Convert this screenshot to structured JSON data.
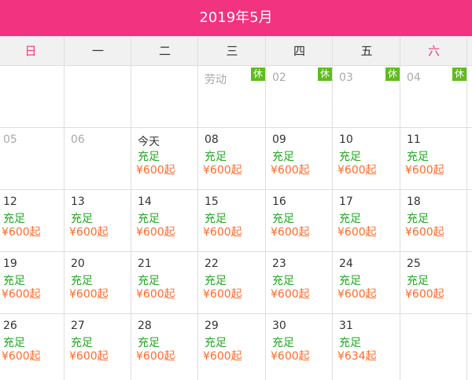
{
  "calendar": {
    "title": "2019年5月",
    "colors": {
      "accent": "#f2337f",
      "available": "#22a722",
      "price": "#ff6a2b",
      "holiday_badge": "#5fbc1e"
    },
    "weekdays": [
      "日",
      "一",
      "二",
      "三",
      "四",
      "五",
      "六"
    ],
    "weeks": [
      [
        {
          "day": "",
          "status": "",
          "price": "",
          "badge": "",
          "dim": false
        },
        {
          "day": "",
          "status": "",
          "price": "",
          "badge": "",
          "dim": false
        },
        {
          "day": "",
          "status": "",
          "price": "",
          "badge": "",
          "dim": false
        },
        {
          "day": "劳动",
          "status": "",
          "price": "",
          "badge": "休",
          "dim": true
        },
        {
          "day": "02",
          "status": "",
          "price": "",
          "badge": "休",
          "dim": true
        },
        {
          "day": "03",
          "status": "",
          "price": "",
          "badge": "休",
          "dim": true
        },
        {
          "day": "04",
          "status": "",
          "price": "",
          "badge": "休",
          "dim": true
        }
      ],
      [
        {
          "day": "05",
          "status": "",
          "price": "",
          "badge": "",
          "dim": true
        },
        {
          "day": "06",
          "status": "",
          "price": "",
          "badge": "",
          "dim": true
        },
        {
          "day": "今天",
          "status": "充足",
          "price": "¥600起",
          "badge": "",
          "dim": false
        },
        {
          "day": "08",
          "status": "充足",
          "price": "¥600起",
          "badge": "",
          "dim": false
        },
        {
          "day": "09",
          "status": "充足",
          "price": "¥600起",
          "badge": "",
          "dim": false
        },
        {
          "day": "10",
          "status": "充足",
          "price": "¥600起",
          "badge": "",
          "dim": false
        },
        {
          "day": "11",
          "status": "充足",
          "price": "¥600起",
          "badge": "",
          "dim": false
        }
      ],
      [
        {
          "day": "12",
          "status": "充足",
          "price": "¥600起",
          "badge": "",
          "dim": false
        },
        {
          "day": "13",
          "status": "充足",
          "price": "¥600起",
          "badge": "",
          "dim": false
        },
        {
          "day": "14",
          "status": "充足",
          "price": "¥600起",
          "badge": "",
          "dim": false
        },
        {
          "day": "15",
          "status": "充足",
          "price": "¥600起",
          "badge": "",
          "dim": false
        },
        {
          "day": "16",
          "status": "充足",
          "price": "¥600起",
          "badge": "",
          "dim": false
        },
        {
          "day": "17",
          "status": "充足",
          "price": "¥600起",
          "badge": "",
          "dim": false
        },
        {
          "day": "18",
          "status": "充足",
          "price": "¥600起",
          "badge": "",
          "dim": false
        }
      ],
      [
        {
          "day": "19",
          "status": "充足",
          "price": "¥600起",
          "badge": "",
          "dim": false
        },
        {
          "day": "20",
          "status": "充足",
          "price": "¥600起",
          "badge": "",
          "dim": false
        },
        {
          "day": "21",
          "status": "充足",
          "price": "¥600起",
          "badge": "",
          "dim": false
        },
        {
          "day": "22",
          "status": "充足",
          "price": "¥600起",
          "badge": "",
          "dim": false
        },
        {
          "day": "23",
          "status": "充足",
          "price": "¥600起",
          "badge": "",
          "dim": false
        },
        {
          "day": "24",
          "status": "充足",
          "price": "¥600起",
          "badge": "",
          "dim": false
        },
        {
          "day": "25",
          "status": "充足",
          "price": "¥600起",
          "badge": "",
          "dim": false
        }
      ],
      [
        {
          "day": "26",
          "status": "充足",
          "price": "¥600起",
          "badge": "",
          "dim": false
        },
        {
          "day": "27",
          "status": "充足",
          "price": "¥600起",
          "badge": "",
          "dim": false
        },
        {
          "day": "28",
          "status": "充足",
          "price": "¥600起",
          "badge": "",
          "dim": false
        },
        {
          "day": "29",
          "status": "充足",
          "price": "¥600起",
          "badge": "",
          "dim": false
        },
        {
          "day": "30",
          "status": "充足",
          "price": "¥600起",
          "badge": "",
          "dim": false
        },
        {
          "day": "31",
          "status": "充足",
          "price": "¥634起",
          "badge": "",
          "dim": false
        },
        {
          "day": "",
          "status": "",
          "price": "",
          "badge": "",
          "dim": false
        }
      ]
    ]
  }
}
